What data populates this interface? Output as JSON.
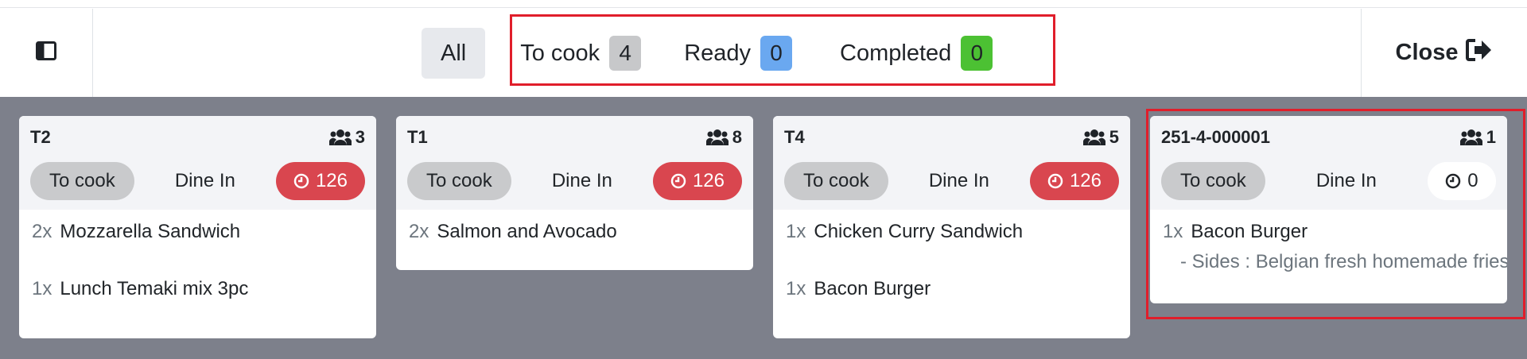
{
  "header": {
    "filters": {
      "all_label": "All",
      "to_cook_label": "To cook",
      "to_cook_count": "4",
      "ready_label": "Ready",
      "ready_count": "0",
      "completed_label": "Completed",
      "completed_count": "0"
    },
    "close_label": "Close"
  },
  "orders": [
    {
      "title": "T2",
      "guests": "3",
      "status": "To cook",
      "type": "Dine In",
      "timer": "126",
      "timer_state": "late",
      "lines": [
        {
          "qty": "2x",
          "name": "Mozzarella Sandwich"
        },
        {
          "qty": "1x",
          "name": "Lunch Temaki mix 3pc"
        }
      ]
    },
    {
      "title": "T1",
      "guests": "8",
      "status": "To cook",
      "type": "Dine In",
      "timer": "126",
      "timer_state": "late",
      "lines": [
        {
          "qty": "2x",
          "name": "Salmon and Avocado"
        }
      ]
    },
    {
      "title": "T4",
      "guests": "5",
      "status": "To cook",
      "type": "Dine In",
      "timer": "126",
      "timer_state": "late",
      "lines": [
        {
          "qty": "1x",
          "name": "Chicken Curry Sandwich"
        },
        {
          "qty": "1x",
          "name": "Bacon Burger"
        }
      ]
    },
    {
      "title": "251-4-000001",
      "guests": "1",
      "status": "To cook",
      "type": "Dine In",
      "timer": "0",
      "timer_state": "normal",
      "lines": [
        {
          "qty": "1x",
          "name": "Bacon Burger",
          "note": "- Sides : Belgian fresh homemade fries"
        }
      ]
    }
  ],
  "colors": {
    "board_bg": "#7d808b",
    "timer_late": "#d9464f",
    "highlight": "#e01e2b",
    "badge_ready": "#6aa8f0",
    "badge_completed": "#4cc133"
  }
}
